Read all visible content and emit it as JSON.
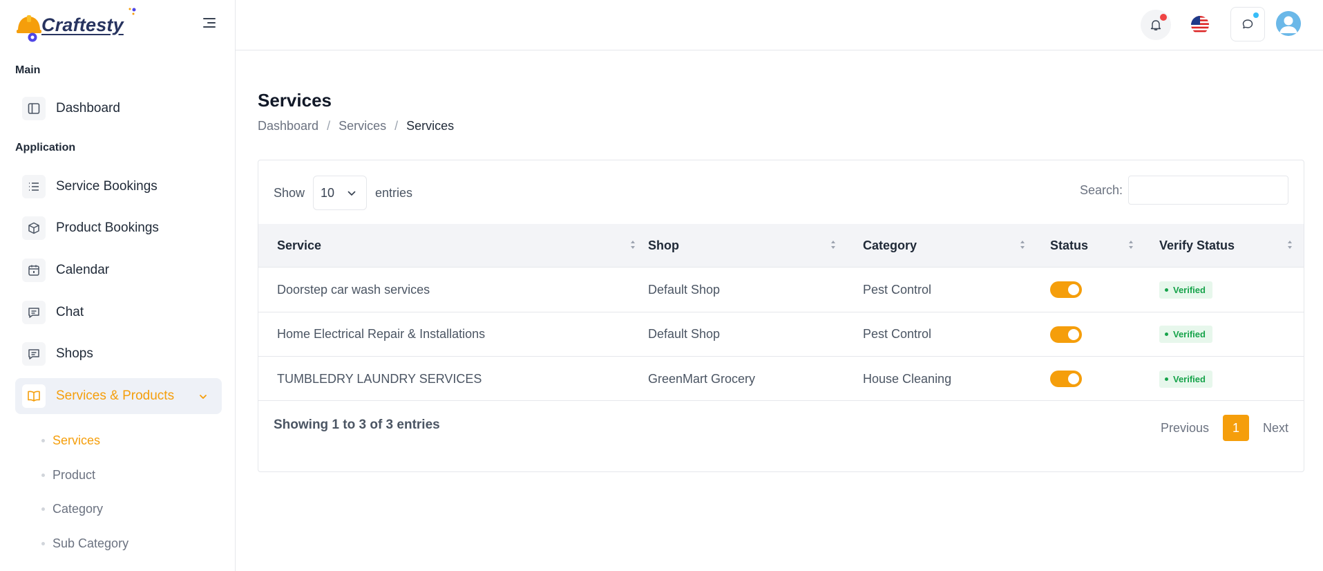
{
  "brand": {
    "name": "Craftesty",
    "logo_icon": "hardhat-gear-icon",
    "accent": "#f59e0b"
  },
  "header": {
    "menu_icon": "hamburger-icon",
    "notification_icon": "bell-icon",
    "language_icon": "us-flag-icon",
    "chat_icon": "chat-bubble-icon",
    "avatar_icon": "user-avatar-icon"
  },
  "sidebar": {
    "section_main": "Main",
    "section_application": "Application",
    "items": [
      {
        "label": "Dashboard",
        "icon": "layout-icon"
      },
      {
        "label": "Service Bookings",
        "icon": "list-icon"
      },
      {
        "label": "Product Bookings",
        "icon": "box-icon"
      },
      {
        "label": "Calendar",
        "icon": "calendar-icon"
      },
      {
        "label": "Chat",
        "icon": "message-icon"
      },
      {
        "label": "Shops",
        "icon": "message-icon"
      },
      {
        "label": "Services & Products",
        "icon": "book-icon"
      }
    ],
    "sub_items": [
      {
        "label": "Services"
      },
      {
        "label": "Product"
      },
      {
        "label": "Category"
      },
      {
        "label": "Sub Category"
      }
    ]
  },
  "page": {
    "title": "Services",
    "breadcrumb": [
      "Dashboard",
      "Services",
      "Services"
    ]
  },
  "table_controls": {
    "show_label": "Show",
    "entries_label": "entries",
    "page_length": "10",
    "search_label": "Search:",
    "search_placeholder": ""
  },
  "table": {
    "columns": [
      "Service",
      "Shop",
      "Category",
      "Status",
      "Verify Status"
    ],
    "rows": [
      {
        "service": "Doorstep car wash services",
        "shop": "Default Shop",
        "category": "Pest Control",
        "status_on": true,
        "verify": "Verified"
      },
      {
        "service": "Home Electrical Repair & Installations",
        "shop": "Default Shop",
        "category": "Pest Control",
        "status_on": true,
        "verify": "Verified"
      },
      {
        "service": "TUMBLEDRY LAUNDRY SERVICES",
        "shop": "GreenMart Grocery",
        "category": "House Cleaning",
        "status_on": true,
        "verify": "Verified"
      }
    ]
  },
  "footer": {
    "info": "Showing 1 to 3 of 3 entries",
    "previous": "Previous",
    "current_page": "1",
    "next": "Next"
  }
}
